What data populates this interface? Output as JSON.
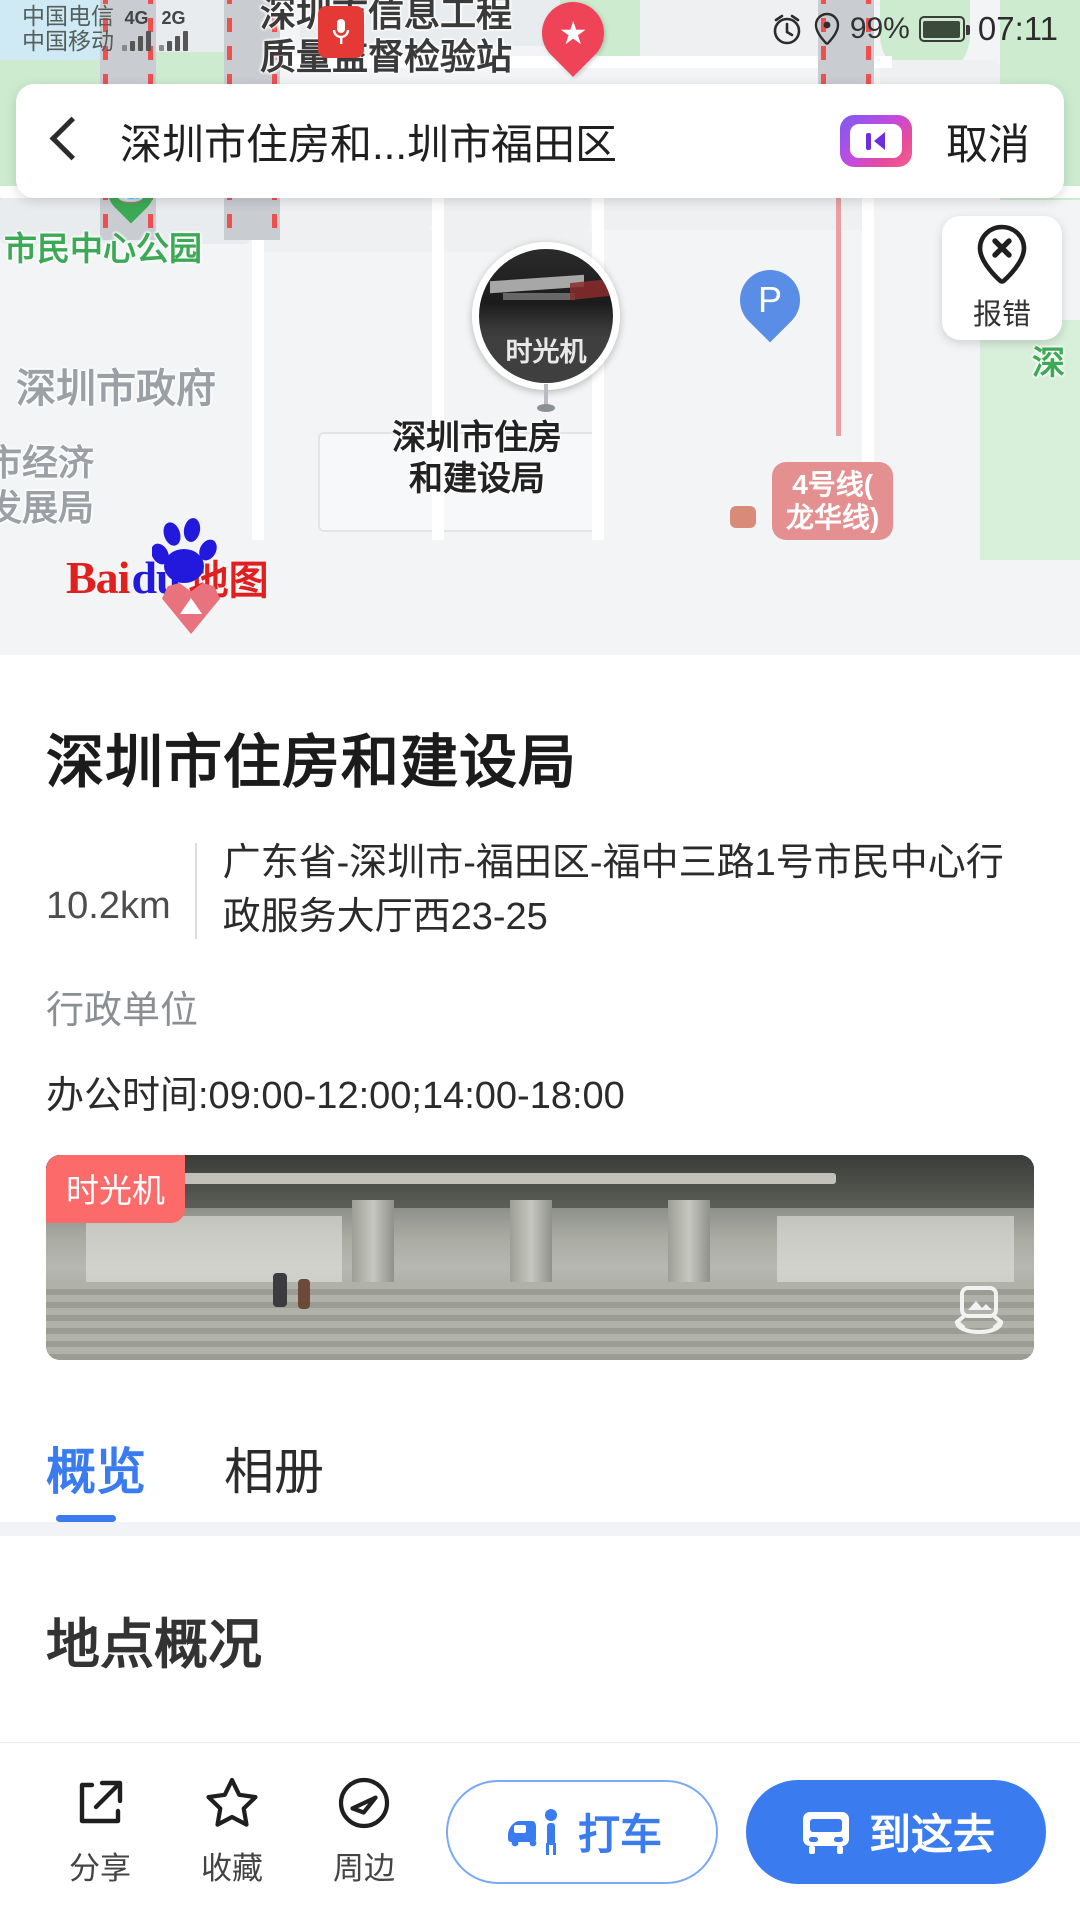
{
  "status_bar": {
    "carrier_1": "中国电信",
    "carrier_2": "中国移动",
    "net_1": "4G",
    "net_2": "2G",
    "battery_percent": "99%",
    "time": "07:11",
    "alarm_icon": "alarm-clock-icon",
    "location_icon": "location-pin-icon"
  },
  "search_bar": {
    "back_icon": "back-chevron-icon",
    "query": "深圳市住房和...圳市福田区",
    "keyboard_icon": "voice-keyboard-icon",
    "cancel_label": "取消"
  },
  "map": {
    "labels": {
      "top_poi_line1": "深圳市信息工程",
      "top_poi_line2": "质量监督检验站",
      "park": "市民中心公园",
      "government": "深圳市政府",
      "selected_poi_line1": "深圳市住房",
      "selected_poi_line2": "和建设局",
      "left_poi_line1": "市经济",
      "left_poi_line2": "发展局",
      "right_green": "深"
    },
    "marker_badge": "时光机",
    "parking_label": "P",
    "metro_line_1": "4号线(",
    "metro_line_2": "龙华线)",
    "report_button": {
      "label": "报错",
      "icon": "report-error-pin-icon"
    },
    "logo": {
      "text_1": "Bai",
      "text_2": "du",
      "text_3": "地图",
      "icon": "baidu-paw-icon"
    }
  },
  "detail": {
    "title": "深圳市住房和建设局",
    "distance": "10.2km",
    "address": "广东省-深圳市-福田区-福中三路1号市民中心行政服务大厅西23-25",
    "category": "行政单位",
    "hours": "办公时间:09:00-12:00;14:00-18:00",
    "photo_badge": "时光机",
    "panorama_icon": "panorama-photo-icon",
    "tabs": [
      {
        "label": "概览",
        "active": true
      },
      {
        "label": "相册",
        "active": false
      }
    ],
    "section_title": "地点概况"
  },
  "action_bar": {
    "items": [
      {
        "label": "分享",
        "icon": "share-icon"
      },
      {
        "label": "收藏",
        "icon": "star-icon"
      },
      {
        "label": "周边",
        "icon": "compass-icon"
      }
    ],
    "taxi_label": "打车",
    "taxi_icon": "taxi-icon",
    "go_label": "到这去",
    "go_icon": "bus-icon"
  },
  "colors": {
    "accent_blue": "#3a7bf0",
    "park_green": "#3caa55",
    "badge_red": "#fc6a6a",
    "metro_red": "#e59090"
  }
}
